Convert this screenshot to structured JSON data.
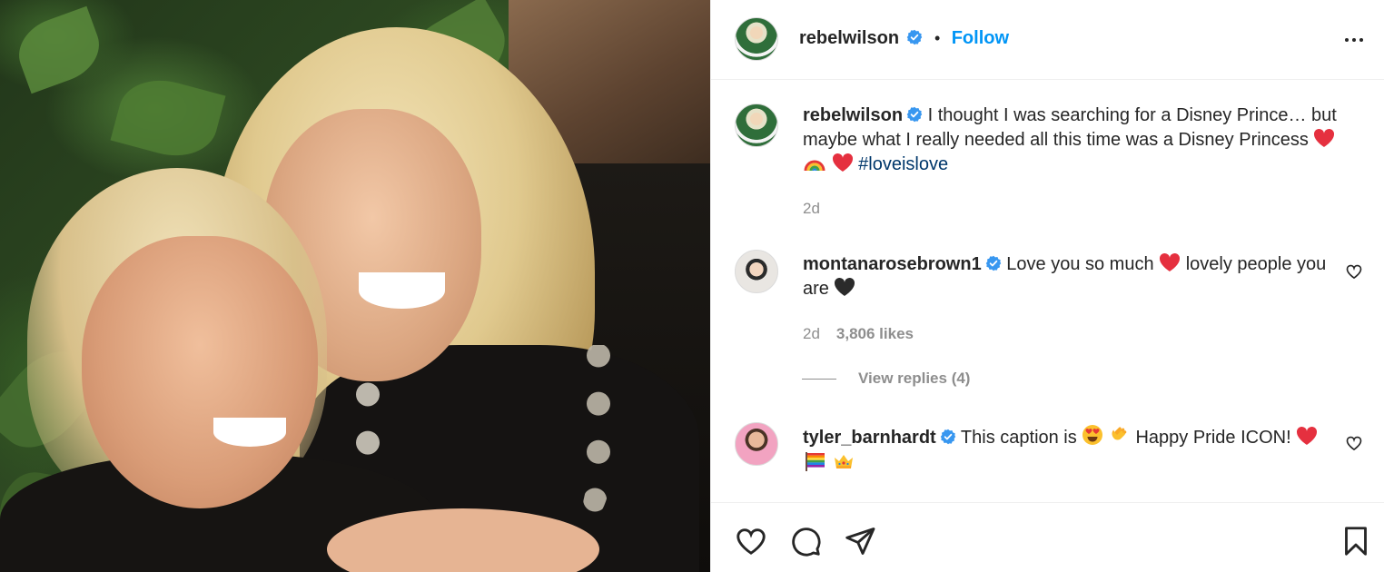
{
  "post": {
    "author": "rebelwilson",
    "follow_label": "Follow",
    "separator": "•"
  },
  "caption": {
    "username": "rebelwilson",
    "text": "I thought I was searching for a Disney Prince… but maybe what I really needed all this time was a Disney Princess",
    "hashtag": "#loveislove",
    "time": "2d"
  },
  "comments": [
    {
      "username": "montanarosebrown1",
      "text_a": "Love you so much",
      "text_b": "lovely people you are",
      "time": "2d",
      "likes": "3,806 likes",
      "view_replies": "View replies (4)"
    },
    {
      "username": "tyler_barnhardt",
      "text_a": "This caption is",
      "text_b": "Happy Pride ICON!"
    }
  ],
  "colors": {
    "accent": "#0095f6",
    "verified": "#3897f0",
    "hashtag": "#00376b",
    "muted": "#8e8e8e",
    "heart_red": "#ed4956"
  },
  "icons": {
    "more": "more-horizontal-icon",
    "like": "heart-outline-icon",
    "comment": "comment-bubble-icon",
    "share": "paper-plane-icon",
    "save": "bookmark-icon"
  }
}
